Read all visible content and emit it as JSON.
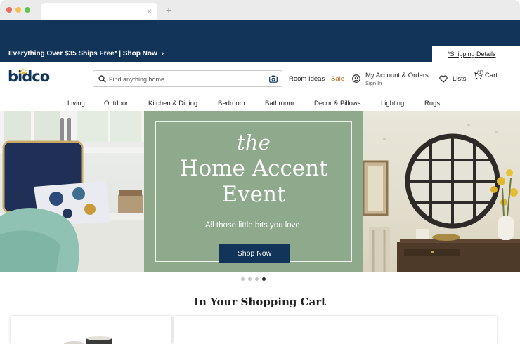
{
  "browser": {
    "tab_title": "",
    "tab_close": "×",
    "new_tab": "+"
  },
  "promo": {
    "text": "Everything Over $35 Ships Free* | Shop Now",
    "chevron": "›",
    "shipping_details": "*Shipping Details"
  },
  "header": {
    "logo": "bidco",
    "search_placeholder": "Find anything home...",
    "room_ideas": "Room Ideas",
    "sale": "Sale",
    "account_title": "My Account & Orders",
    "account_sub": "Sign In",
    "lists": "Lists",
    "cart": "Cart",
    "cart_count": "1"
  },
  "nav": {
    "items": [
      "Living",
      "Outdoor",
      "Kitchen & Dining",
      "Bedroom",
      "Bathroom",
      "Decor & Pillows",
      "Lighting",
      "Rugs"
    ]
  },
  "hero": {
    "the": "the",
    "title_line1": "Home Accent",
    "title_line2": "Event",
    "subtitle": "All those little bits you love.",
    "button": "Shop Now",
    "slide_count": 4,
    "active_slide": 4
  },
  "cart_section": {
    "heading": "In Your Shopping Cart"
  },
  "colors": {
    "navy": "#123458",
    "sage": "#8fa98d",
    "sale": "#b8651b"
  },
  "icons": [
    "search-icon",
    "camera-icon",
    "account-icon",
    "heart-icon",
    "cart-icon",
    "sun-icon"
  ]
}
